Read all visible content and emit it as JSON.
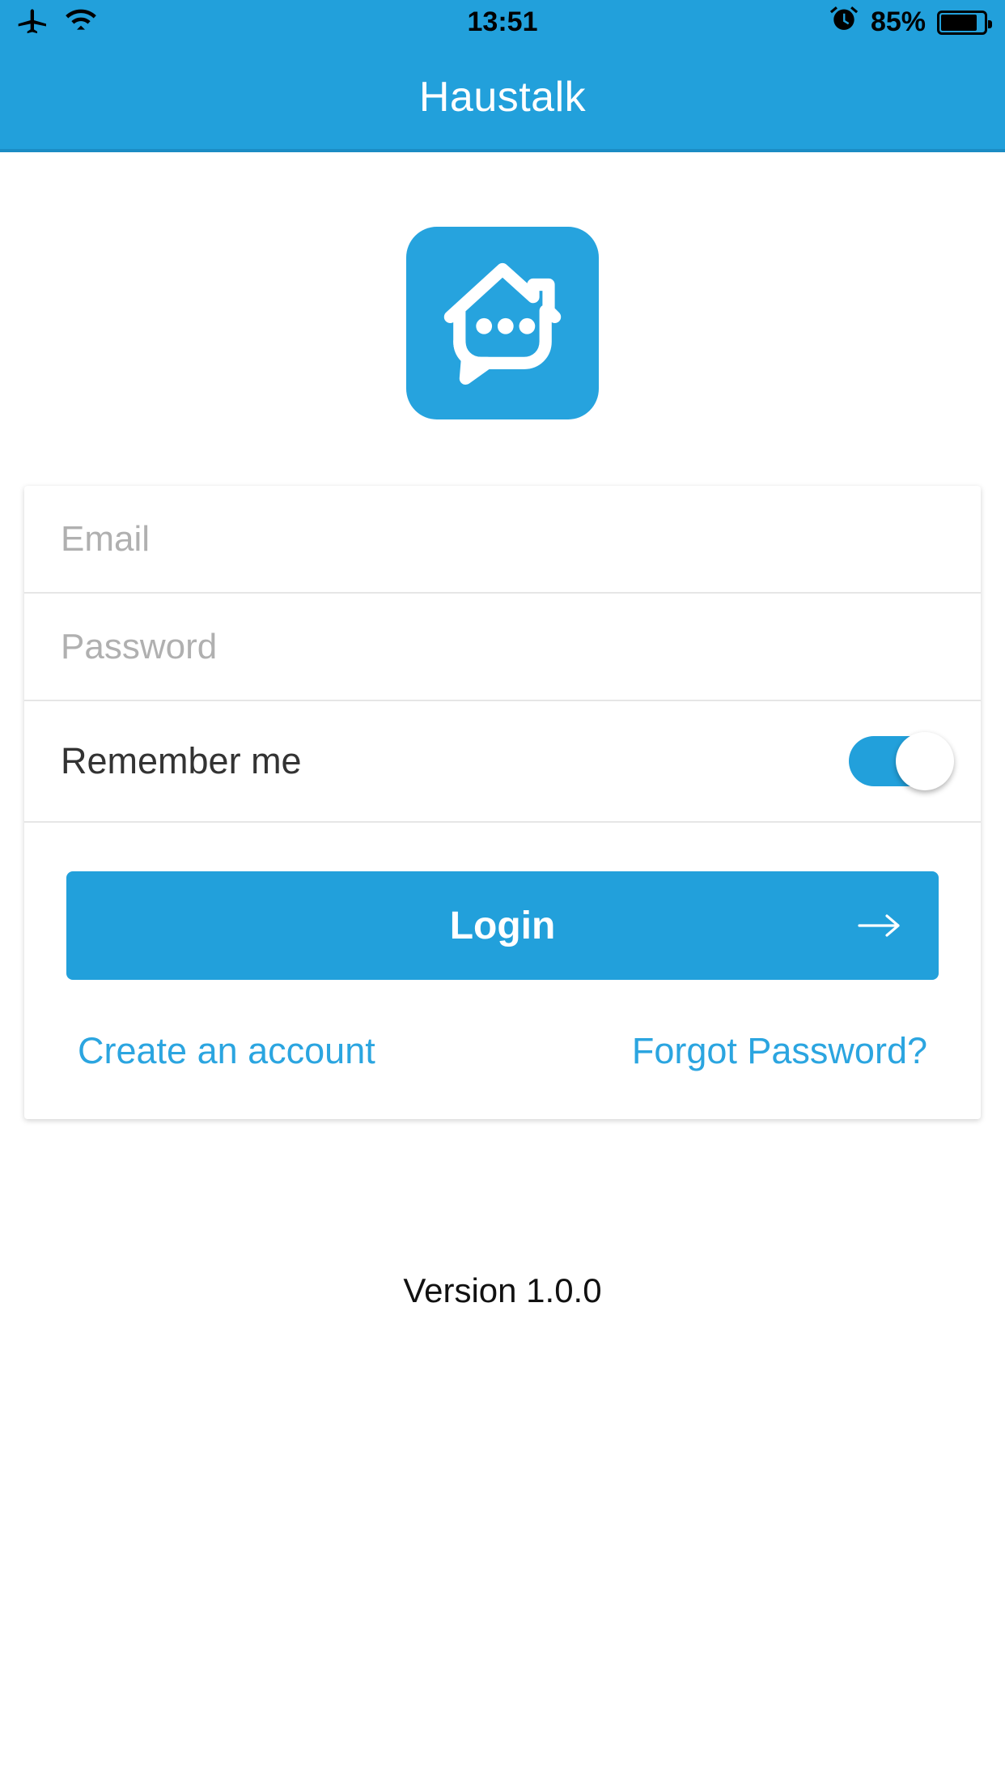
{
  "status_bar": {
    "airplane_icon": "airplane-mode-icon",
    "wifi_icon": "wifi-icon",
    "time": "13:51",
    "alarm_icon": "alarm-clock-icon",
    "battery_percent": "85%",
    "battery_level": 85
  },
  "header": {
    "title": "Haustalk",
    "background_color": "#22a0db"
  },
  "logo": {
    "icon_name": "haustalk-house-chat-logo",
    "background_color": "#26a3de"
  },
  "form": {
    "email": {
      "placeholder": "Email",
      "value": ""
    },
    "password": {
      "placeholder": "Password",
      "value": ""
    },
    "remember_me": {
      "label": "Remember me",
      "enabled": true
    }
  },
  "actions": {
    "login_label": "Login",
    "login_arrow_icon": "arrow-right-icon",
    "create_account_label": "Create an account",
    "forgot_password_label": "Forgot Password?"
  },
  "footer": {
    "version": "Version 1.0.0"
  },
  "colors": {
    "accent": "#22a0db",
    "link": "#2ba5e0",
    "placeholder": "#b0b0b0",
    "divider": "#e6e6e6"
  }
}
